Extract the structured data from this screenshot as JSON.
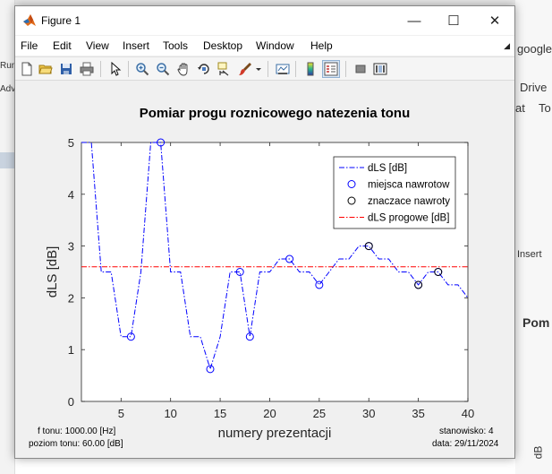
{
  "window": {
    "title": "Figure 1",
    "minimize_glyph": "—",
    "maximize_glyph": "☐",
    "close_glyph": "✕"
  },
  "menu": {
    "items": [
      "File",
      "Edit",
      "View",
      "Insert",
      "Tools",
      "Desktop",
      "Window",
      "Help"
    ]
  },
  "toolbar": {
    "icons": [
      "new-figure-icon",
      "open-file-icon",
      "save-icon",
      "print-icon",
      "pointer-icon",
      "zoom-in-icon",
      "zoom-out-icon",
      "pan-icon",
      "rotate-3d-icon",
      "data-cursor-icon",
      "brush-icon",
      "brush-dropdown-icon",
      "link-plot-icon",
      "insert-colorbar-icon",
      "insert-legend-icon",
      "hide-plot-tools-icon",
      "show-plot-tools-icon"
    ]
  },
  "background": {
    "left_texts": [
      "Run",
      "Adv"
    ],
    "right_texts": [
      "google",
      "Drive",
      "at",
      "To",
      "Insert",
      "Pom",
      "dB"
    ]
  },
  "info": {
    "freq": "f tonu: 1000.00 [Hz]",
    "level": "poziom tonu: 60.00 [dB]",
    "station": "stanowisko: 4",
    "date": "data: 29/11/2024"
  },
  "chart_data": {
    "type": "line",
    "title": "Pomiar progu roznicowego natezenia tonu",
    "xlabel": "numery prezentacji",
    "ylabel": "dLS [dB]",
    "xlim": [
      1,
      40
    ],
    "ylim": [
      0,
      5
    ],
    "xticks": [
      5,
      10,
      15,
      20,
      25,
      30,
      35,
      40
    ],
    "yticks": [
      0,
      1,
      2,
      3,
      4,
      5
    ],
    "grid": false,
    "legend_position": "top-right",
    "legend": [
      "dLS [dB]",
      "miejsca nawrotow",
      "znaczace nawroty",
      "dLS progowe [dB]"
    ],
    "series": [
      {
        "name": "dLS [dB]",
        "style": "dash-dot",
        "color": "#0000ff",
        "x": [
          1,
          2,
          3,
          4,
          5,
          6,
          7,
          8,
          9,
          10,
          11,
          12,
          13,
          14,
          15,
          16,
          17,
          18,
          19,
          20,
          21,
          22,
          23,
          24,
          25,
          26,
          27,
          28,
          29,
          30,
          31,
          32,
          33,
          34,
          35,
          36,
          37,
          38,
          39,
          40
        ],
        "y": [
          5,
          5,
          2.5,
          2.5,
          1.25,
          1.25,
          2.5,
          5,
          5,
          2.5,
          2.5,
          1.25,
          1.25,
          0.625,
          1.25,
          2.5,
          2.5,
          1.25,
          2.5,
          2.5,
          2.75,
          2.75,
          2.5,
          2.5,
          2.25,
          2.5,
          2.75,
          2.75,
          3,
          3,
          2.75,
          2.75,
          2.5,
          2.5,
          2.25,
          2.5,
          2.5,
          2.25,
          2.25,
          2
        ]
      },
      {
        "name": "miejsca nawrotow",
        "style": "circle",
        "color": "#0000ff",
        "x": [
          6,
          9,
          14,
          17,
          18,
          22,
          25,
          30,
          35,
          37
        ],
        "y": [
          1.25,
          5,
          0.625,
          2.5,
          1.25,
          2.75,
          2.25,
          3,
          2.25,
          2.5
        ]
      },
      {
        "name": "znaczace nawroty",
        "style": "circle",
        "color": "#000000",
        "x": [
          30,
          35,
          37
        ],
        "y": [
          3,
          2.25,
          2.5
        ]
      },
      {
        "name": "dLS progowe [dB]",
        "style": "dash-dot",
        "color": "#ff0000",
        "x": [
          1,
          40
        ],
        "y": [
          2.6,
          2.6
        ]
      }
    ]
  }
}
